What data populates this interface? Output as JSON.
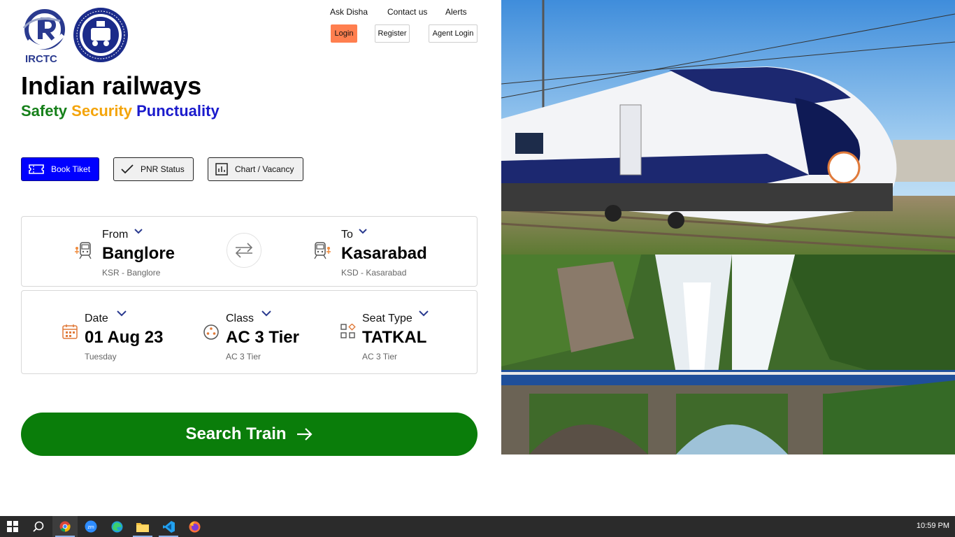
{
  "brand": {
    "irctc_logo_text": "IRCTC",
    "indian_railways_logo_text": "INDIAN RAILWAYS"
  },
  "topnav": {
    "ask_disha": "Ask Disha",
    "contact_us": "Contact us",
    "alerts": "Alerts"
  },
  "auth": {
    "login": "Login",
    "register": "Register",
    "agent_login": "Agent Login"
  },
  "hero": {
    "title": "Indian railways",
    "tag_safety": "Safety",
    "tag_security": "Security",
    "tag_punctuality": "Punctuality"
  },
  "tabs": {
    "book": "Book Tiket",
    "pnr": "PNR Status",
    "chart": "Chart / Vacancy"
  },
  "route": {
    "from_label": "From",
    "from_value": "Banglore",
    "from_sub": "KSR - Banglore",
    "to_label": "To",
    "to_value": "Kasarabad",
    "to_sub": "KSD - Kasarabad"
  },
  "details": {
    "date_label": "Date",
    "date_value": "01 Aug 23",
    "date_sub": "Tuesday",
    "class_label": "Class",
    "class_value": "AC 3 Tier",
    "class_sub": "AC 3 Tier",
    "seat_label": "Seat Type",
    "seat_value": "TATKAL",
    "seat_sub": "AC 3 Tier"
  },
  "search": {
    "label": "Search Train"
  },
  "taskbar": {
    "time": "10:59 PM",
    "apps": [
      "start-icon",
      "search-icon",
      "chrome-icon",
      "zoom-icon",
      "edge-icon",
      "file-explorer-icon",
      "vscode-icon",
      "firefox-icon"
    ]
  },
  "colors": {
    "primary_blue": "#0000ff",
    "search_green": "#0a7d0a",
    "login_orange": "#ff7f4f"
  }
}
